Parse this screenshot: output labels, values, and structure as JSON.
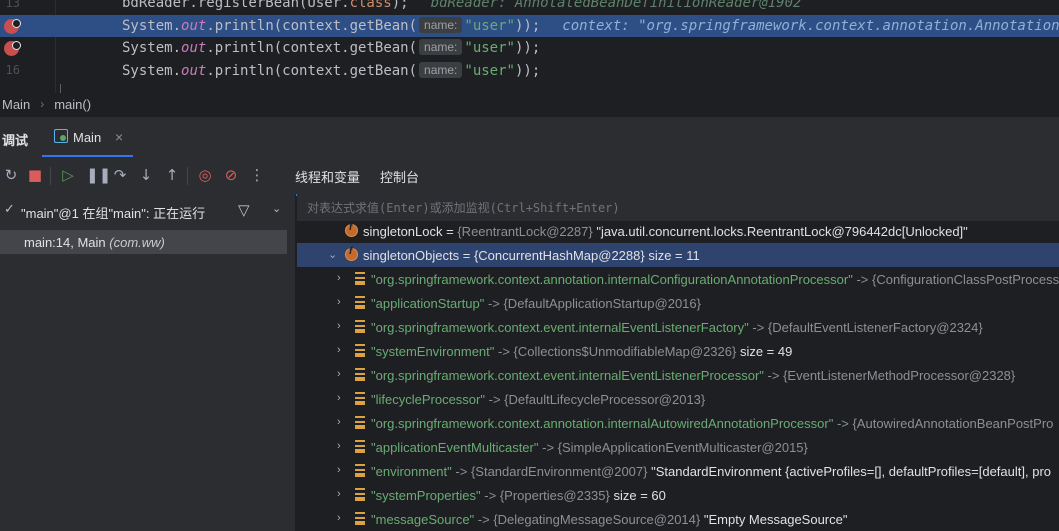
{
  "editor": {
    "lines": [
      {
        "num": "13",
        "code_prefix": "bdReader.registerBean(User.",
        "code_kw": "class",
        "code_suffix": ");",
        "inline": "bdReader: AnnotatedBeanDefinitionReader@1902"
      },
      {
        "num": "",
        "code_a": "System.",
        "code_fld": "out",
        "code_b": ".println(context.getBean(",
        "hint": "name:",
        "code_str": "\"user\"",
        "code_c": "));",
        "inline": "context: \"org.springframework.context.annotation.AnnotationConfig"
      },
      {
        "num": "",
        "code_a": "System.",
        "code_fld": "out",
        "code_b": ".println(context.getBean(",
        "hint": "name:",
        "code_str": "\"user\"",
        "code_c": "));"
      },
      {
        "num": "16",
        "code_a": "System.",
        "code_fld": "out",
        "code_b": ".println(context.getBean(",
        "hint": "name:",
        "code_str": "\"user\"",
        "code_c": "));"
      }
    ]
  },
  "breadcrumb": {
    "items": [
      "Main",
      "main()"
    ]
  },
  "debug": {
    "tool_title": "调试",
    "tab_label": "Main",
    "tab_close": "×"
  },
  "toolbar": {
    "icons": [
      "rerun-icon",
      "stop-icon",
      "resume-icon",
      "pause-icon",
      "step-over-icon",
      "step-into-icon",
      "step-out-icon",
      "view-breakpoints-icon",
      "mute-breakpoints-icon",
      "more-icon"
    ],
    "tabs": [
      "线程和变量",
      "控制台"
    ]
  },
  "frames": {
    "thread_check": "✓",
    "thread_label": "\"main\"@1 在组\"main\": 正在运行",
    "frame_main": "main:14, Main ",
    "frame_pkg": "(com.ww)"
  },
  "eval": {
    "placeholder": "对表达式求值(Enter)或添加监视(Ctrl+Shift+Enter)"
  },
  "variables": [
    {
      "name": "singletonLock",
      "type": "{ReentrantLock@2287}",
      "value": "\"java.util.concurrent.locks.ReentrantLock@796442dc[Unlocked]\""
    },
    {
      "name": "singletonObjects",
      "type": "= {ConcurrentHashMap@2288}",
      "value": "size = 11"
    },
    {
      "key": "\"org.springframework.context.annotation.internalConfigurationAnnotationProcessor\"",
      "type": "-> {ConfigurationClassPostProcessor",
      "value": ""
    },
    {
      "key": "\"applicationStartup\"",
      "type": "-> {DefaultApplicationStartup@2016}",
      "value": ""
    },
    {
      "key": "\"org.springframework.context.event.internalEventListenerFactory\"",
      "type": "-> {DefaultEventListenerFactory@2324}",
      "value": ""
    },
    {
      "key": "\"systemEnvironment\"",
      "type": "-> {Collections$UnmodifiableMap@2326}",
      "value": "size = 49"
    },
    {
      "key": "\"org.springframework.context.event.internalEventListenerProcessor\"",
      "type": "-> {EventListenerMethodProcessor@2328}",
      "value": ""
    },
    {
      "key": "\"lifecycleProcessor\"",
      "type": "-> {DefaultLifecycleProcessor@2013}",
      "value": ""
    },
    {
      "key": "\"org.springframework.context.annotation.internalAutowiredAnnotationProcessor\"",
      "type": "-> {AutowiredAnnotationBeanPostPro",
      "value": ""
    },
    {
      "key": "\"applicationEventMulticaster\"",
      "type": "-> {SimpleApplicationEventMulticaster@2015}",
      "value": ""
    },
    {
      "key": "\"environment\"",
      "type": "-> {StandardEnvironment@2007}",
      "value": "\"StandardEnvironment {activeProfiles=[], defaultProfiles=[default], pro"
    },
    {
      "key": "\"systemProperties\"",
      "type": "-> {Properties@2335}",
      "value": "size = 60"
    },
    {
      "key": "\"messageSource\"",
      "type": "-> {DelegatingMessageSource@2014}",
      "value": "\"Empty MessageSource\""
    }
  ]
}
